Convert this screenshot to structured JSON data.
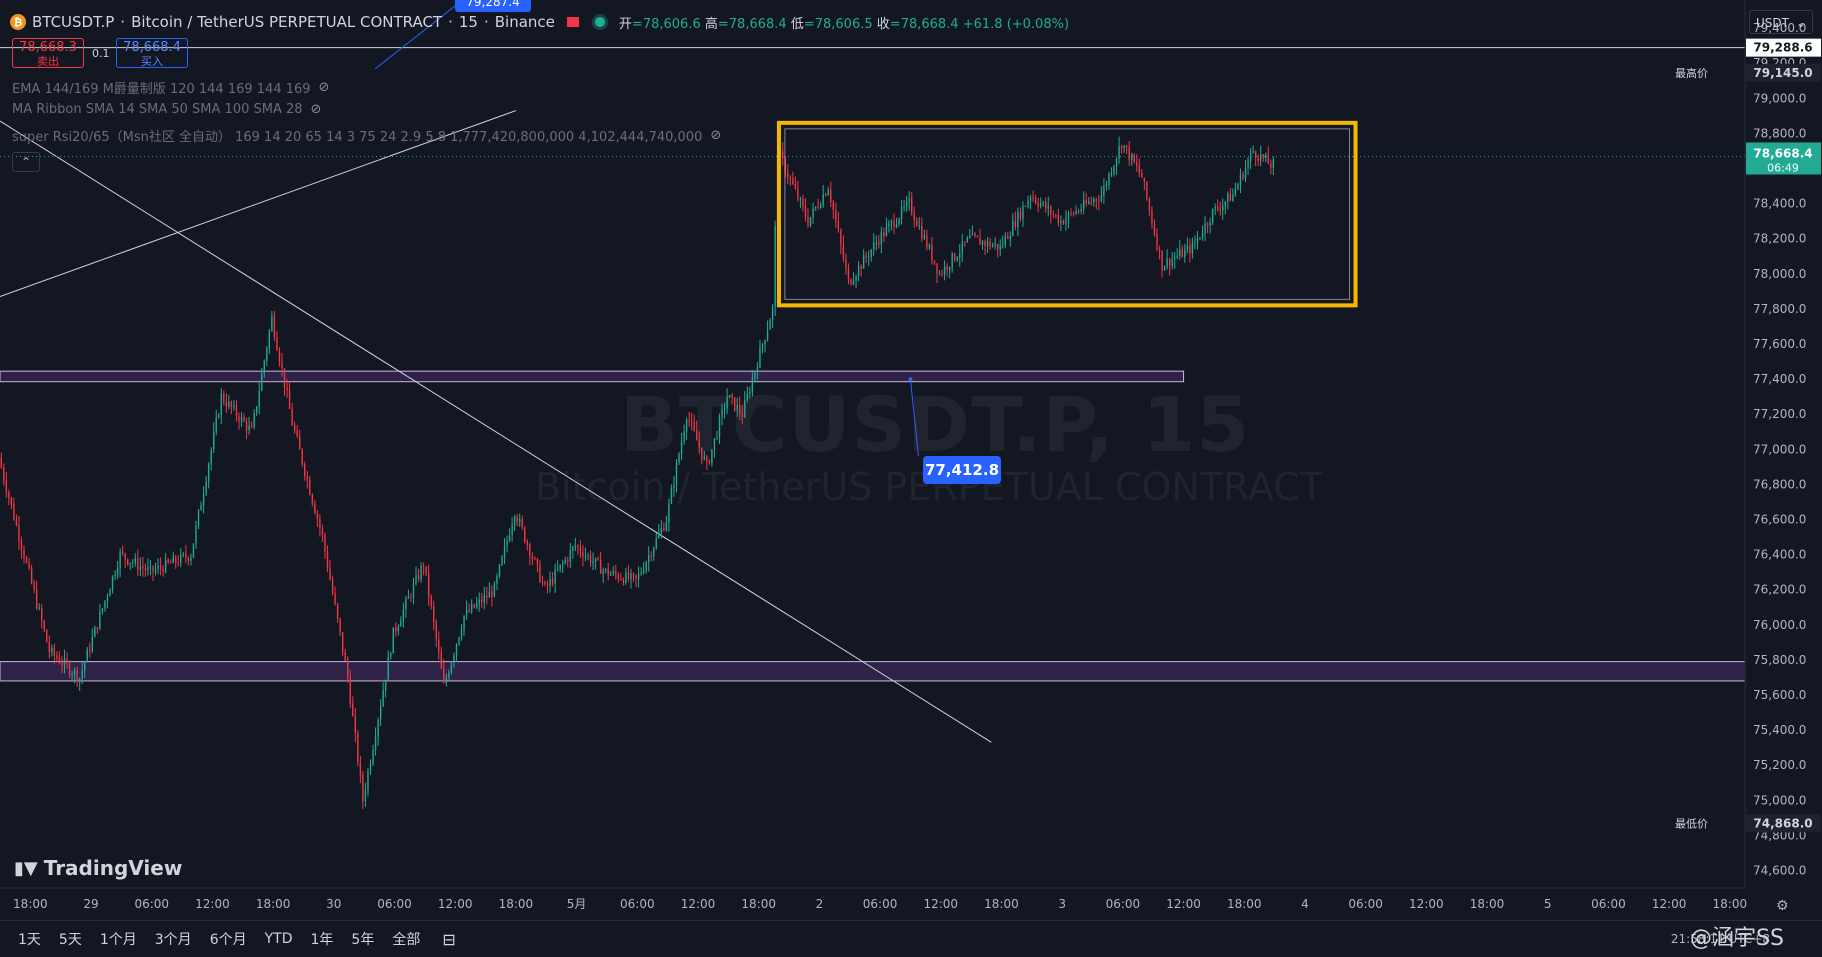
{
  "header": {
    "symbol": "BTCUSDT.P",
    "description": "Bitcoin / TetherUS PERPETUAL CONTRACT",
    "interval": "15",
    "exchange": "Binance",
    "coin_icon": "bitcoin-icon",
    "open_label": "开",
    "open": "78,606.6",
    "high_label": "高",
    "high": "78,668.4",
    "low_label": "低",
    "low": "78,606.5",
    "close_label": "收",
    "close": "78,668.4",
    "change": "+61.8 (+0.08%)"
  },
  "trade": {
    "sell_price": "78,668.3",
    "sell_label": "卖出",
    "spread": "0.1",
    "buy_price": "78,668.4",
    "buy_label": "买入"
  },
  "indicators": [
    {
      "name": "EMA 144/169 M爵量制版 120 144 169 144 169"
    },
    {
      "name": "MA Ribbon SMA 14 SMA 50 SMA 100 SMA 28"
    },
    {
      "name": "super Rsi20/65（Msn社区 全自动） 169 14 20 65 14 3 75 24 2.9 5.8 1,777,420,800,000 4,102,444,740,000"
    }
  ],
  "watermark": {
    "line1": "BTCUSDT.P, 15",
    "line2": "Bitcoin / TetherUS PERPETUAL CONTRACT"
  },
  "logo": "TradingView",
  "currency_button": "USDT",
  "price_callout": "77,412.8",
  "top_tag": "79,287.4",
  "price_axis": {
    "ticks": [
      "79,400.0",
      "79,200.0",
      "79,000.0",
      "78,800.0",
      "78,600.0",
      "78,400.0",
      "78,200.0",
      "78,000.0",
      "77,800.0",
      "77,600.0",
      "77,400.0",
      "77,200.0",
      "77,000.0",
      "76,800.0",
      "76,600.0",
      "76,400.0",
      "76,200.0",
      "76,000.0",
      "75,800.0",
      "75,600.0",
      "75,400.0",
      "75,200.0",
      "75,000.0",
      "74,800.0",
      "74,600.0"
    ],
    "hline_label": "79,288.6",
    "high_label": "最高价",
    "high_value": "79,145.0",
    "current_price": "78,668.4",
    "countdown": "06:49",
    "low_label": "最低价",
    "low_value": "74,868.0"
  },
  "time_axis": [
    "18:00",
    "29",
    "06:00",
    "12:00",
    "18:00",
    "30",
    "06:00",
    "12:00",
    "18:00",
    "5月",
    "06:00",
    "12:00",
    "18:00",
    "2",
    "06:00",
    "12:00",
    "18:00",
    "3",
    "06:00",
    "12:00",
    "18:00",
    "4",
    "06:00",
    "12:00",
    "18:00",
    "5",
    "06:00",
    "12:00",
    "18:00"
  ],
  "bottom_bar": {
    "ranges": [
      "1天",
      "5天",
      "1个月",
      "3个月",
      "6个月",
      "YTD",
      "1年",
      "5年",
      "全部"
    ],
    "time_text": "21:58:11 UTC+8",
    "credit": "@涵宇SS"
  },
  "colors": {
    "up": "#22ab94",
    "down": "#f23645",
    "box": "#f5b700",
    "zone": "#9c6fd6",
    "bg": "#131722"
  },
  "chart_data": {
    "type": "candlestick",
    "x_range": [
      "04-28 15:00",
      "05-05 19:30"
    ],
    "y_range": [
      74500,
      79560
    ],
    "bar_interval_minutes": 15,
    "key_points": [
      [
        "04-28 15:00",
        76950
      ],
      [
        "04-28 20:00",
        75850
      ],
      [
        "04-28 23:00",
        75700
      ],
      [
        "04-29 03:00",
        76400
      ],
      [
        "04-29 06:00",
        76300
      ],
      [
        "04-29 10:00",
        76400
      ],
      [
        "04-29 13:00",
        77300
      ],
      [
        "04-29 16:00",
        77100
      ],
      [
        "04-29 18:00",
        77750
      ],
      [
        "04-29 20:00",
        77150
      ],
      [
        "04-29 23:00",
        76500
      ],
      [
        "04-30 01:30",
        75700
      ],
      [
        "04-30 03:00",
        75000
      ],
      [
        "04-30 06:00",
        75950
      ],
      [
        "04-30 09:00",
        76350
      ],
      [
        "04-30 11:00",
        75650
      ],
      [
        "04-30 13:00",
        76050
      ],
      [
        "04-30 16:00",
        76200
      ],
      [
        "04-30 18:00",
        76650
      ],
      [
        "04-30 21:00",
        76200
      ],
      [
        "05-01 00:00",
        76450
      ],
      [
        "05-01 03:00",
        76300
      ],
      [
        "05-01 06:00",
        76250
      ],
      [
        "05-01 09:00",
        76600
      ],
      [
        "05-01 11:00",
        77200
      ],
      [
        "05-01 13:00",
        76900
      ],
      [
        "05-01 15:00",
        77300
      ],
      [
        "05-01 16:30",
        77200
      ],
      [
        "05-01 18:00",
        77500
      ],
      [
        "05-01 19:30",
        77800
      ],
      [
        "05-01 20:00",
        78700
      ],
      [
        "05-01 23:00",
        78300
      ],
      [
        "05-02 01:00",
        78500
      ],
      [
        "05-02 03:00",
        77950
      ],
      [
        "05-02 06:00",
        78200
      ],
      [
        "05-02 09:00",
        78400
      ],
      [
        "05-02 12:00",
        78000
      ],
      [
        "05-02 15:00",
        78200
      ],
      [
        "05-02 18:00",
        78150
      ],
      [
        "05-02 21:00",
        78450
      ],
      [
        "05-03 00:00",
        78300
      ],
      [
        "05-03 04:00",
        78450
      ],
      [
        "05-03 06:00",
        78750
      ],
      [
        "05-03 08:00",
        78550
      ],
      [
        "05-03 10:00",
        78050
      ],
      [
        "05-03 13:00",
        78150
      ],
      [
        "05-03 15:00",
        78350
      ],
      [
        "05-03 17:00",
        78450
      ],
      [
        "05-03 19:00",
        78700
      ],
      [
        "05-03 20:45",
        78620
      ]
    ],
    "annotations": {
      "range_box": {
        "x0": "05-01 20:00",
        "x1": "05-04 05:00",
        "y0": 77820,
        "y1": 78860
      },
      "zones": [
        {
          "x0": "04-28 15:00",
          "x1": "05-03 12:00",
          "y0": 77385,
          "y1": 77445
        },
        {
          "x0": "04-28 15:00",
          "x1": "05-05 19:30",
          "y0": 75680,
          "y1": 75790
        }
      ],
      "hline": 79288.6
    }
  }
}
